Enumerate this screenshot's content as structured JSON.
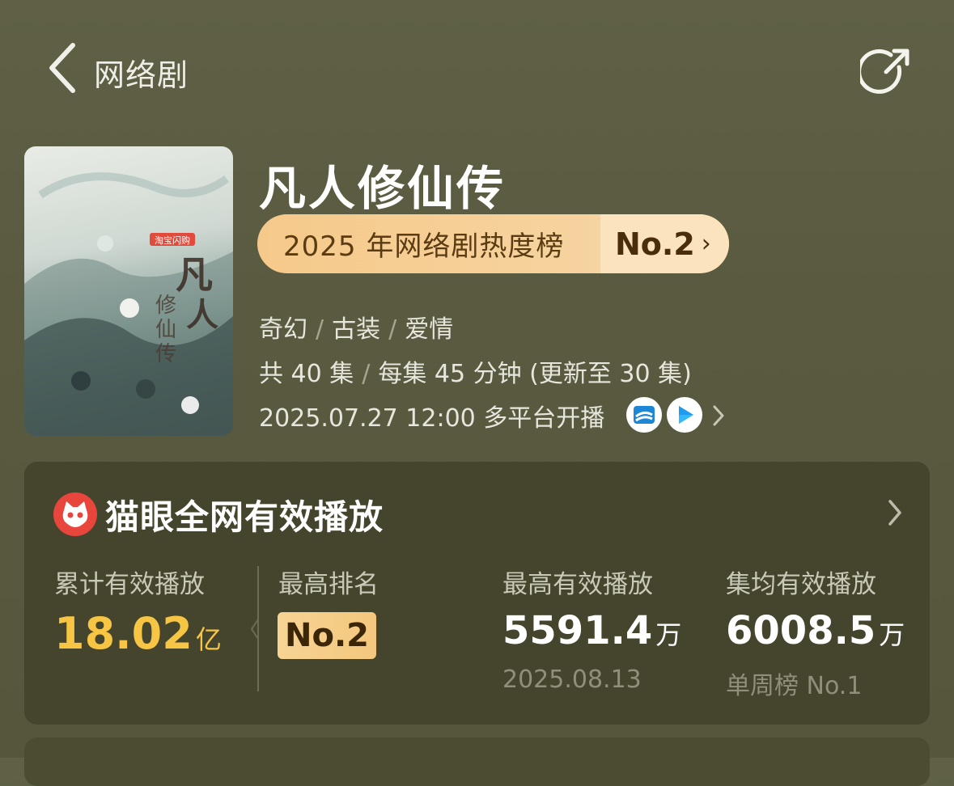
{
  "header": {
    "back_icon": "chevron-left-icon",
    "title": "网络剧",
    "share_icon": "share-icon"
  },
  "poster": {
    "alt": "凡人修仙传",
    "badge": "淘宝闪购"
  },
  "show": {
    "title": "凡人修仙传",
    "ranking_label": "2025 年网络剧热度榜",
    "ranking_value": "No.2",
    "genres": [
      "奇幻",
      "古装",
      "爱情"
    ],
    "episodes": "共 40 集",
    "duration": "每集 45 分钟 (更新至 30 集)",
    "premiere": "2025.07.27 12:00 多平台开播"
  },
  "card": {
    "title": "猫眼全网有效播放",
    "stats": [
      {
        "label": "累计有效播放",
        "value": "18.02",
        "unit": "亿"
      },
      {
        "label": "最高排名",
        "value": "No.2"
      },
      {
        "label": "最高有效播放",
        "value": "5591.4",
        "unit": "万",
        "sub": "2025.08.13"
      },
      {
        "label": "集均有效播放",
        "value": "6008.5",
        "unit": "万",
        "sub": "单周榜 No.1"
      }
    ]
  },
  "colors": {
    "accent_gold": "#f6c544",
    "pill_bg": "#f5c98a",
    "card_bg": "#45452e"
  }
}
